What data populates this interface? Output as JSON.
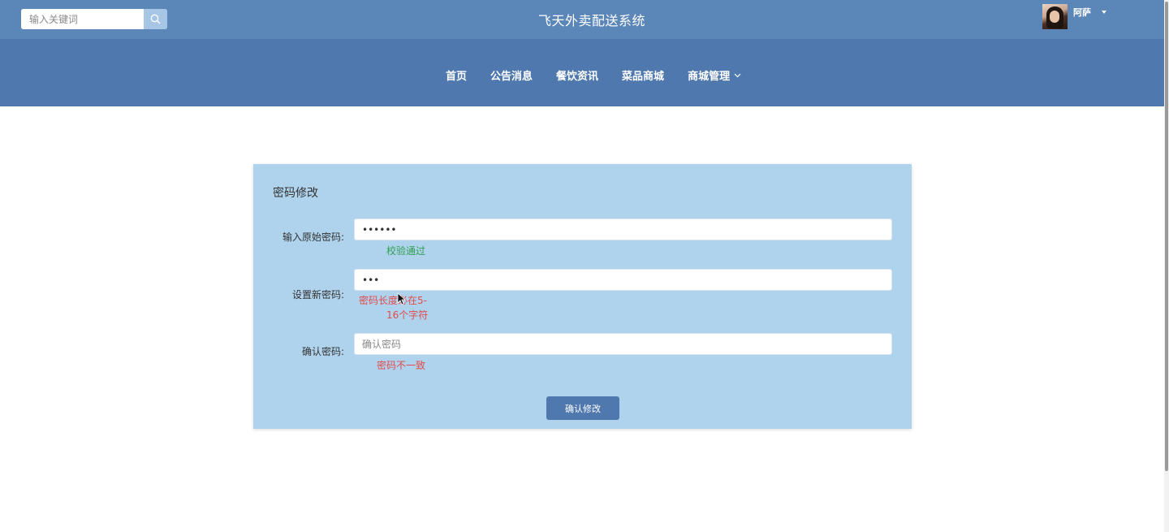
{
  "header": {
    "search_placeholder": "输入关键词",
    "search_icon": "search-icon",
    "site_title": "飞天外卖配送系统",
    "user": {
      "name": "阿萨",
      "avatar_icon": "avatar-photo"
    }
  },
  "nav": {
    "items": [
      {
        "label": "首页"
      },
      {
        "label": "公告消息"
      },
      {
        "label": "餐饮资讯"
      },
      {
        "label": "菜品商城"
      },
      {
        "label": "商城管理",
        "icon": "chevron-down-icon"
      }
    ]
  },
  "form": {
    "title": "密码修改",
    "old_password": {
      "label": "输入原始密码:",
      "value": "••••••",
      "message": "校验通过",
      "status": "success"
    },
    "new_password": {
      "label": "设置新密码:",
      "value": "•••",
      "message_line1": "密码长度必在5-",
      "message_line2": "16个字符",
      "status": "error"
    },
    "confirm_password": {
      "label": "确认密码:",
      "placeholder": "确认密码",
      "message": "密码不一致",
      "status": "error"
    },
    "submit_label": "确认修改"
  },
  "colors": {
    "topbar": "#5b86b8",
    "navbar": "#4f78ae",
    "card": "#afd3ed",
    "success": "#2e9e4f",
    "error": "#e14b4b"
  }
}
